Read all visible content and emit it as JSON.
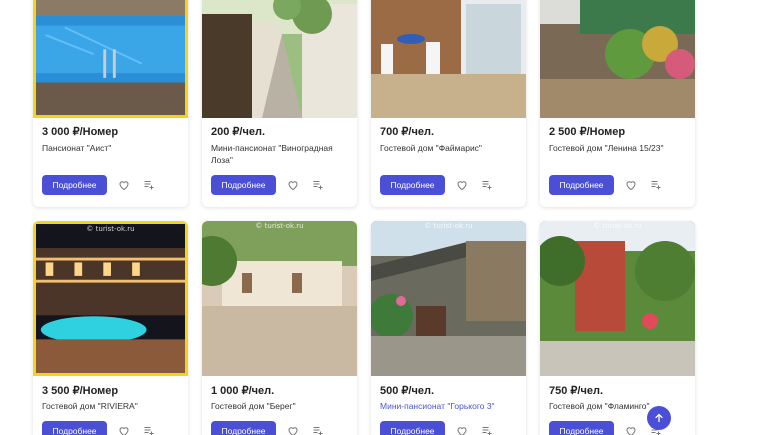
{
  "listings": [
    {
      "price": "3 000 ₽/Номер",
      "name": "Пансионат \"Аист\"",
      "button": "Подробнее"
    },
    {
      "price": "200 ₽/чел.",
      "name": "Мини-пансионат \"Виноградная Лоза\"",
      "button": "Подробнее"
    },
    {
      "price": "700 ₽/чел.",
      "name": "Гостевой дом \"Файмарис\"",
      "button": "Подробнее"
    },
    {
      "price": "2 500 ₽/Номер",
      "name": "Гостевой дом \"Ленина 15/23\"",
      "button": "Подробнее"
    },
    {
      "price": "3 500 ₽/Номер",
      "name": "Гостевой дом \"RIVIERA\"",
      "button": "Подробнее",
      "watermark": "© turist-ok.ru"
    },
    {
      "price": "1 000 ₽/чел.",
      "name": "Гостевой дом \"Берег\"",
      "button": "Подробнее",
      "watermark": "© turist-ok.ru"
    },
    {
      "price": "500 ₽/чел.",
      "name": "Мини-пансионат \"Горького 3\"",
      "button": "Подробнее",
      "watermark": "© turist-ok.ru"
    },
    {
      "price": "750 ₽/чел.",
      "name": "Гостевой дом \"Фламинго\"",
      "button": "Подробнее",
      "watermark": "© turist-ok.ru"
    }
  ],
  "colors": {
    "accent": "#4b4fd6",
    "featured_border": "#f3d31b",
    "link": "#4a55d6"
  },
  "icons": {
    "favorite": "heart-outline-icon",
    "compare": "list-plus-icon",
    "scroll_top": "arrow-up-icon"
  }
}
